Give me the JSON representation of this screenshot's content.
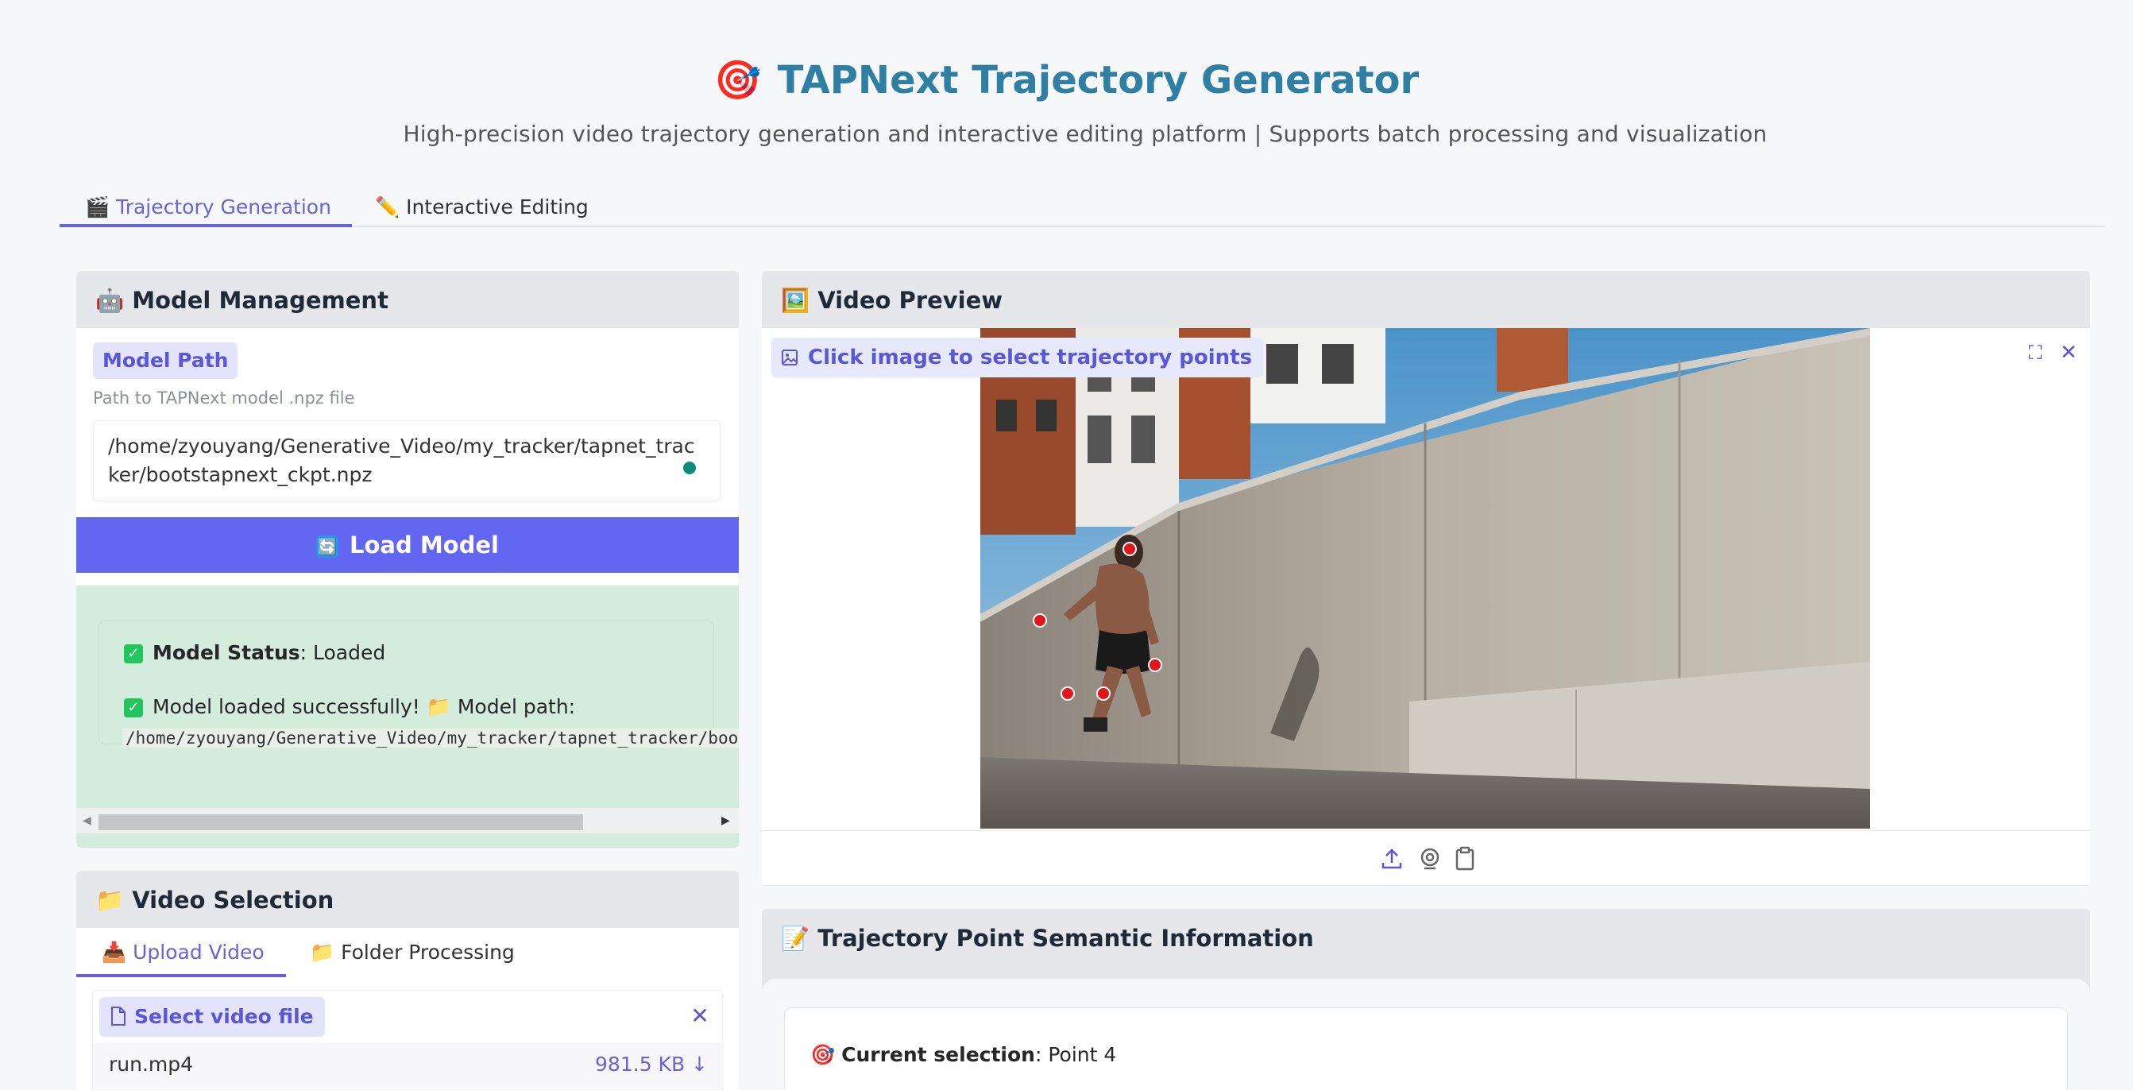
{
  "header": {
    "title_emoji": "🎯",
    "title": "TAPNext Trajectory Generator",
    "subtitle": "High-precision video trajectory generation and interactive editing platform | Supports batch processing and visualization"
  },
  "tabs": [
    {
      "icon": "🎬",
      "label": "Trajectory Generation",
      "active": true
    },
    {
      "icon": "✏️",
      "label": "Interactive Editing",
      "active": false
    }
  ],
  "model_management": {
    "icon": "🤖",
    "heading": "Model Management",
    "path_label": "Model Path",
    "path_info": "Path to TAPNext model .npz file",
    "path_value": "/home/zyouyang/Generative_Video/my_tracker/tapnet_tracker/bootstapnext_ckpt.npz",
    "load_button_icon": "🔄",
    "load_button": "Load Model",
    "status_label": "Model Status",
    "status_value": ": Loaded",
    "success_text": "Model loaded successfully!",
    "path_prefix_icon": "📁",
    "path_prefix": "Model path:",
    "loaded_path": "/home/zyouyang/Generative_Video/my_tracker/tapnet_tracker/bootstapnext_ckpt.npz"
  },
  "video_selection": {
    "icon": "📁",
    "heading": "Video Selection",
    "tabs": [
      {
        "icon": "📥",
        "label": "Upload Video",
        "active": true
      },
      {
        "icon": "📁",
        "label": "Folder Processing",
        "active": false
      }
    ],
    "select_label": "Select video file",
    "file_name": "run.mp4",
    "file_size": "981.5 KB ↓"
  },
  "video_preview": {
    "icon": "🖼️",
    "heading": "Video Preview",
    "image_label": "Click image to select trajectory points",
    "point_color": "#e0161c"
  },
  "semantic_info": {
    "icon": "📝",
    "heading": "Trajectory Point Semantic Information",
    "selection_icon": "🎯",
    "selection_label": "Current selection",
    "selection_value": ": Point 4"
  },
  "colors": {
    "accent": "#6366f1",
    "title": "#2f7fa5",
    "success_bg": "#d4ecdc"
  }
}
